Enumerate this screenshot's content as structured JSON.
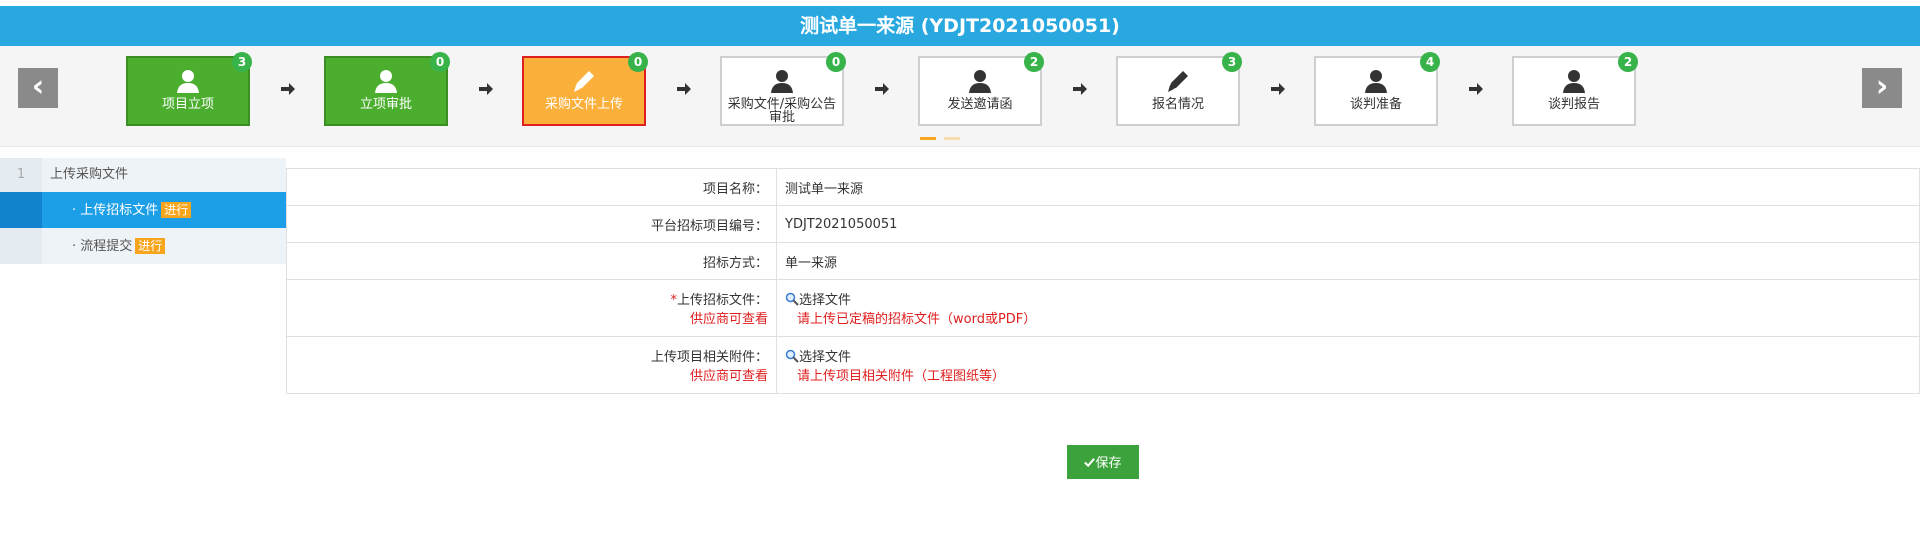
{
  "header": {
    "title": "测试单一来源 (YDJT2021050051)"
  },
  "nav": {
    "prev": "‹",
    "next": "›"
  },
  "steps": [
    {
      "label": "项目立项",
      "count": "3",
      "state": "done",
      "icon": "user-icon"
    },
    {
      "label": "立项审批",
      "count": "0",
      "state": "done",
      "icon": "user-icon"
    },
    {
      "label": "采购文件上传",
      "count": "0",
      "state": "current",
      "icon": "pencil-icon"
    },
    {
      "label": "采购文件/采购公告审批",
      "count": "0",
      "state": "todo",
      "icon": "user-icon"
    },
    {
      "label": "发送邀请函",
      "count": "2",
      "state": "todo",
      "icon": "user-icon"
    },
    {
      "label": "报名情况",
      "count": "3",
      "state": "todo",
      "icon": "pencil-icon"
    },
    {
      "label": "谈判准备",
      "count": "4",
      "state": "todo",
      "icon": "user-icon"
    },
    {
      "label": "谈判报告",
      "count": "2",
      "state": "todo",
      "icon": "user-icon"
    }
  ],
  "sidebar": {
    "section_num": "1",
    "section_title": "上传采购文件",
    "items": [
      {
        "label": "· 上传招标文件",
        "tag": "进行",
        "active": true
      },
      {
        "label": "· 流程提交",
        "tag": "进行",
        "active": false
      }
    ]
  },
  "form": {
    "rows": [
      {
        "label": "项目名称：",
        "value": "测试单一来源"
      },
      {
        "label": "平台招标项目编号：",
        "value": "YDJT2021050051"
      },
      {
        "label": "招标方式：",
        "value": "单一来源"
      }
    ],
    "upload_rows": [
      {
        "required": "*",
        "label": "上传招标文件：",
        "sub": "供应商可查看",
        "button": "选择文件",
        "hint": "请上传已定稿的招标文件（word或PDF）"
      },
      {
        "required": "",
        "label": "上传项目相关附件：",
        "sub": "供应商可查看",
        "button": "选择文件",
        "hint": "请上传项目相关附件（工程图纸等）"
      }
    ]
  },
  "save_label": "保存",
  "colors": {
    "header": "#29a8e0",
    "step_done": "#4cae2f",
    "step_current": "#fbb03b",
    "badge": "#37b34a",
    "sidebar_active": "#1d9fe8",
    "tag": "#f7a51c",
    "save": "#3ca33c",
    "required": "#e02020"
  }
}
